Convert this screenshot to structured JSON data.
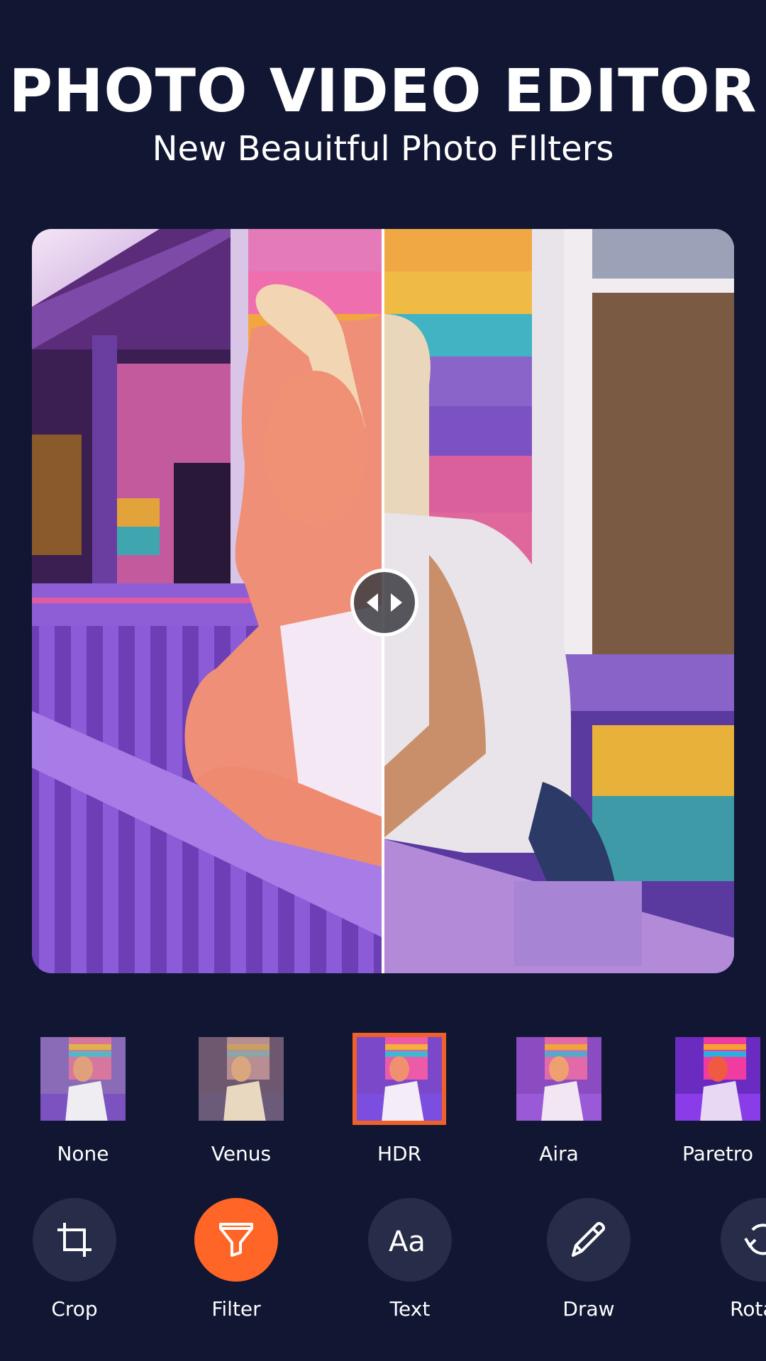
{
  "header": {
    "title": "PHOTO VIDEO EDITOR",
    "subtitle": "New Beauitful Photo FIlters"
  },
  "preview": {
    "compare_handle_icon": "left-right-arrows-icon",
    "left_side": "filtered",
    "right_side": "original"
  },
  "filters": {
    "selected": "HDR",
    "items": [
      {
        "label": "None"
      },
      {
        "label": "Venus"
      },
      {
        "label": "HDR"
      },
      {
        "label": "Aira"
      },
      {
        "label": "Paretro"
      }
    ]
  },
  "tools": {
    "active": "Filter",
    "items": [
      {
        "label": "Crop",
        "icon": "crop-icon"
      },
      {
        "label": "Filter",
        "icon": "funnel-icon"
      },
      {
        "label": "Text",
        "icon": "text-aa-icon"
      },
      {
        "label": "Draw",
        "icon": "pencil-icon"
      },
      {
        "label": "Rotate",
        "icon": "rotate-icon"
      }
    ]
  },
  "colors": {
    "background": "#111633",
    "accent": "#FF6526",
    "selected_border": "#F0612A",
    "tool_button": "#272D48"
  }
}
